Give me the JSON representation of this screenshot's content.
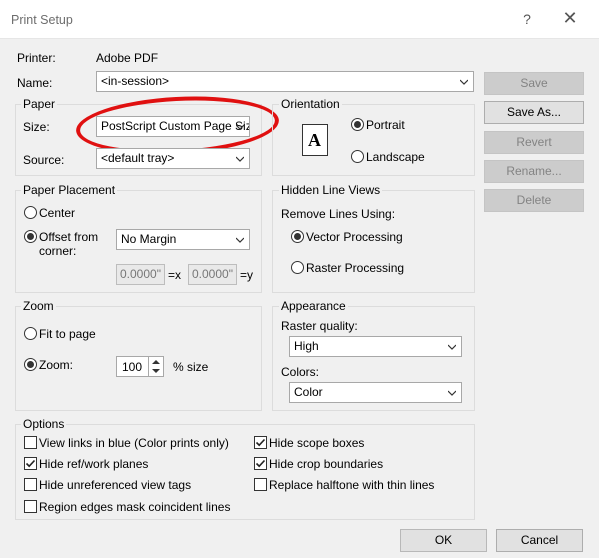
{
  "window": {
    "title": "Print Setup",
    "help_icon": "?",
    "close_icon": "✕"
  },
  "printer": {
    "label": "Printer:",
    "value": "Adobe PDF"
  },
  "name": {
    "label": "Name:",
    "value": "<in-session>"
  },
  "side_buttons": {
    "save": "Save",
    "save_as": "Save As...",
    "revert": "Revert",
    "rename": "Rename...",
    "delete": "Delete"
  },
  "paper": {
    "title": "Paper",
    "size_label": "Size:",
    "size_value": "PostScript Custom Page Size",
    "source_label": "Source:",
    "source_value": "<default tray>"
  },
  "orientation": {
    "title": "Orientation",
    "icon_letter": "A",
    "portrait": "Portrait",
    "landscape": "Landscape"
  },
  "paper_placement": {
    "title": "Paper Placement",
    "center": "Center",
    "offset_line1": "Offset from",
    "offset_line2": "corner:",
    "margin_value": "No Margin",
    "x_value": "0.0000\"",
    "x_suffix": "=x",
    "y_value": "0.0000\"",
    "y_suffix": "=y"
  },
  "hidden_line": {
    "title": "Hidden Line Views",
    "remove_label": "Remove Lines Using:",
    "vector": "Vector Processing",
    "raster": "Raster Processing"
  },
  "zoom": {
    "title": "Zoom",
    "fit": "Fit to page",
    "zoom_label": "Zoom:",
    "zoom_value": "100",
    "size_suffix": "% size"
  },
  "appearance": {
    "title": "Appearance",
    "raster_label": "Raster quality:",
    "raster_value": "High",
    "colors_label": "Colors:",
    "colors_value": "Color"
  },
  "options": {
    "title": "Options",
    "view_links": "View links in blue (Color prints only)",
    "hide_ref": "Hide ref/work planes",
    "hide_unref": "Hide unreferenced view tags",
    "region_edges": "Region edges mask coincident lines",
    "hide_scope": "Hide scope boxes",
    "hide_crop": "Hide crop boundaries",
    "replace_halftone": "Replace halftone with thin lines"
  },
  "footer": {
    "ok": "OK",
    "cancel": "Cancel"
  },
  "colors": {
    "annotation_ring": "#e01010",
    "window_bg": "#f0f0f0"
  }
}
